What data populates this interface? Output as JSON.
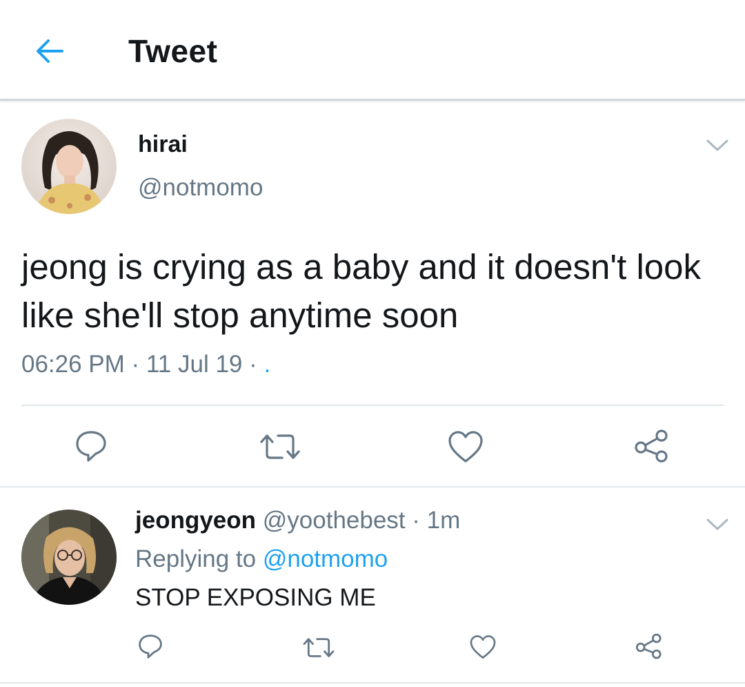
{
  "header": {
    "title": "Tweet",
    "back_icon": "arrow-left-icon",
    "accent": "#1da1f2"
  },
  "tweet": {
    "display_name": "hirai",
    "handle": "@notmomo",
    "text": "jeong is crying as a baby and it doesn't look like she'll stop anytime soon",
    "time": "06:26 PM",
    "date": "11 Jul 19",
    "separator": " · ",
    "trailing": ".",
    "actions": [
      "reply-icon",
      "retweet-icon",
      "like-icon",
      "share-icon"
    ]
  },
  "reply": {
    "display_name": "jeongyeon",
    "handle": "@yoothebest",
    "age": "1m",
    "replying_to_label": "Replying to",
    "replying_to_handle": "@notmomo",
    "text": "STOP EXPOSING ME",
    "actions": [
      "reply-icon",
      "retweet-icon",
      "like-icon",
      "share-icon"
    ]
  },
  "colors": {
    "text": "#14171a",
    "secondary": "#657786",
    "link": "#1da1f2",
    "divider": "#e1e6ea"
  }
}
